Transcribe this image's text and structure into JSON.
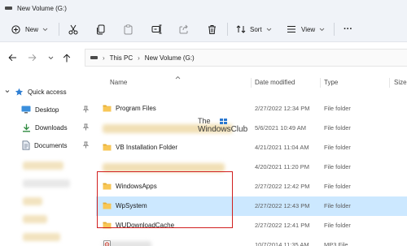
{
  "window": {
    "title": "New Volume (G:)"
  },
  "toolbar": {
    "new_label": "New",
    "sort_label": "Sort",
    "view_label": "View",
    "more_label": "···"
  },
  "address": {
    "crumbs": [
      "This PC",
      "New Volume (G:)"
    ]
  },
  "nav": {
    "quick_access": "Quick access",
    "desktop": "Desktop",
    "downloads": "Downloads",
    "documents": "Documents"
  },
  "columns": {
    "name": "Name",
    "date": "Date modified",
    "type": "Type",
    "size": "Size"
  },
  "files": [
    {
      "name": "Program Files",
      "date": "2/27/2022 12:34 PM",
      "type": "File folder",
      "blurred": false,
      "selected": false,
      "icon": "folder-icon"
    },
    {
      "name": "",
      "date": "5/6/2021 10:49 AM",
      "type": "File folder",
      "blurred": true,
      "selected": false,
      "icon": "folder-icon"
    },
    {
      "name": "VB Installation Folder",
      "date": "4/21/2021 11:04 AM",
      "type": "File folder",
      "blurred": false,
      "selected": false,
      "icon": "folder-icon"
    },
    {
      "name": "",
      "date": "4/20/2021 11:20 PM",
      "type": "File folder",
      "blurred": true,
      "selected": false,
      "icon": "folder-icon"
    },
    {
      "name": "WindowsApps",
      "date": "2/27/2022 12:42 PM",
      "type": "File folder",
      "blurred": false,
      "selected": false,
      "icon": "folder-icon"
    },
    {
      "name": "WpSystem",
      "date": "2/27/2022 12:43 PM",
      "type": "File folder",
      "blurred": false,
      "selected": true,
      "icon": "folder-icon"
    },
    {
      "name": "WUDownloadCache",
      "date": "2/27/2022 12:41 PM",
      "type": "File folder",
      "blurred": false,
      "selected": false,
      "icon": "folder-icon"
    },
    {
      "name": "",
      "date": "10/7/2014 11:35 AM",
      "type": "MP3 File",
      "blurred": true,
      "selected": false,
      "icon": "audio-file-icon"
    }
  ],
  "watermark": {
    "line1": "The",
    "line2": "WindowsClub"
  },
  "colors": {
    "folder": "#f8c757",
    "folder_back": "#e5ad33",
    "selection": "#cce8ff",
    "highlight": "#d11f1f",
    "downloads_arrow": "#2d8a3e",
    "documents": "#6b7a8f",
    "quick_access_star": "#2f7fd3"
  }
}
